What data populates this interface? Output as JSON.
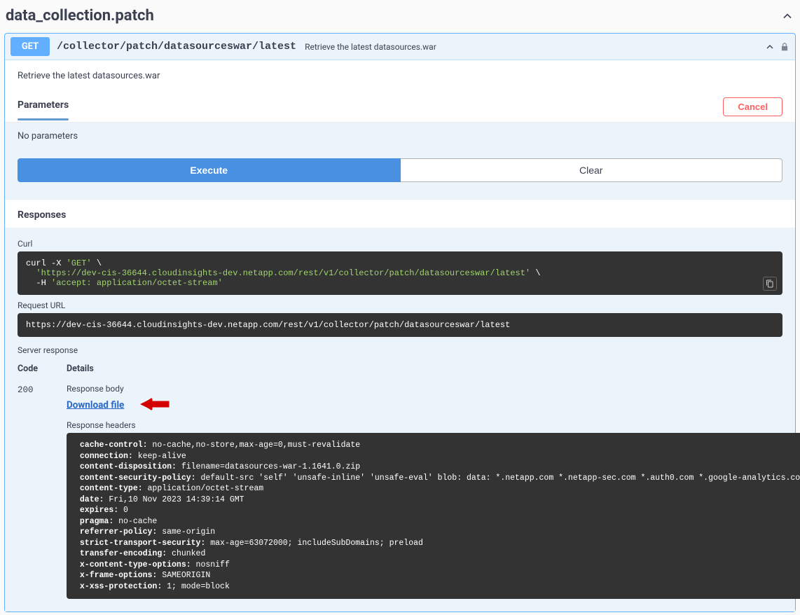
{
  "tag": {
    "name": "data_collection.patch"
  },
  "op": {
    "method": "GET",
    "path": "/collector/patch/datasourceswar/latest",
    "summary": "Retrieve the latest datasources.war",
    "description": "Retrieve the latest datasources.war"
  },
  "parameters": {
    "tab_label": "Parameters",
    "cancel_label": "Cancel",
    "no_params_text": "No parameters"
  },
  "buttons": {
    "execute": "Execute",
    "clear": "Clear"
  },
  "responses_label": "Responses",
  "curl": {
    "label": "Curl",
    "prefix": "curl -X ",
    "method_quoted": "'GET'",
    "url_quoted": "'https://dev-cis-36644.cloudinsights-dev.netapp.com/rest/v1/collector/patch/datasourceswar/latest'",
    "hflag": "-H ",
    "header_quoted": "'accept: application/octet-stream'"
  },
  "request_url": {
    "label": "Request URL",
    "value": "https://dev-cis-36644.cloudinsights-dev.netapp.com/rest/v1/collector/patch/datasourceswar/latest"
  },
  "server_response": {
    "label": "Server response",
    "code_hdr": "Code",
    "details_hdr": "Details",
    "code": "200",
    "body_label": "Response body",
    "download_label": "Download file",
    "headers_label": "Response headers",
    "headers": [
      [
        "cache-control",
        "no-cache,no-store,max-age=0,must-revalidate"
      ],
      [
        "connection",
        "keep-alive"
      ],
      [
        "content-disposition",
        "filename=datasources-war-1.1641.0.zip"
      ],
      [
        "content-security-policy",
        "default-src 'self' 'unsafe-inline' 'unsafe-eval' blob: data: *.netapp.com *.netapp-sec.com *.auth0.com *.google-analytics.com storage.googleapis.com *.spotinst.com"
      ],
      [
        "content-type",
        "application/octet-stream"
      ],
      [
        "date",
        "Fri,10 Nov 2023 14:39:14 GMT"
      ],
      [
        "expires",
        "0"
      ],
      [
        "pragma",
        "no-cache"
      ],
      [
        "referrer-policy",
        "same-origin"
      ],
      [
        "strict-transport-security",
        "max-age=63072000; includeSubDomains; preload"
      ],
      [
        "transfer-encoding",
        "chunked"
      ],
      [
        "x-content-type-options",
        "nosniff"
      ],
      [
        "x-frame-options",
        "SAMEORIGIN"
      ],
      [
        "x-xss-protection",
        "1; mode=block"
      ]
    ]
  }
}
